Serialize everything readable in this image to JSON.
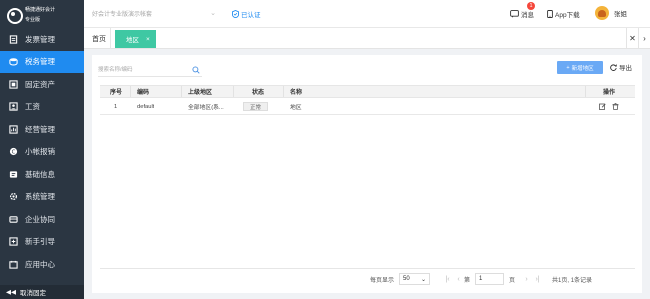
{
  "sidebar": {
    "brand_line1": "畅捷通好会计",
    "brand_line2": "专业版",
    "items": [
      {
        "label": "发票管理",
        "icon": "invoice-icon",
        "active": false
      },
      {
        "label": "税务管理",
        "icon": "tax-icon",
        "active": true
      },
      {
        "label": "固定资产",
        "icon": "asset-icon",
        "active": false
      },
      {
        "label": "工资",
        "icon": "salary-icon",
        "active": false
      },
      {
        "label": "经营管理",
        "icon": "business-icon",
        "active": false
      },
      {
        "label": "小帐报销",
        "icon": "reimburse-icon",
        "active": false
      },
      {
        "label": "基础信息",
        "icon": "info-icon",
        "active": false
      },
      {
        "label": "系统管理",
        "icon": "settings-icon",
        "active": false
      },
      {
        "label": "企业协同",
        "icon": "collab-icon",
        "active": false
      },
      {
        "label": "新手引导",
        "icon": "guide-icon",
        "active": false
      },
      {
        "label": "应用中心",
        "icon": "apps-icon",
        "active": false
      }
    ],
    "footer_label": "取消固定"
  },
  "header": {
    "company_placeholder": "好会计专业版演示帐套",
    "verified_label": "已认证",
    "messages_label": "消息",
    "messages_count": "1",
    "app_download_label": "App下载",
    "user_name": "张姐"
  },
  "tabs": {
    "home_label": "首页",
    "active_label": "地区",
    "close_symbol": "×"
  },
  "toolbar": {
    "search_placeholder": "搜索名称/编码",
    "add_label": "新增地区",
    "export_label": "导出"
  },
  "table": {
    "headers": {
      "index": "序号",
      "code": "编码",
      "parent": "上级地区",
      "status": "状态",
      "name": "名称",
      "actions": "操作"
    },
    "rows": [
      {
        "index": "1",
        "code": "default",
        "parent": "全部地区(系...",
        "status": "正常",
        "name": "地区"
      }
    ]
  },
  "pagination": {
    "per_page_label": "每页显示",
    "per_page_value": "50",
    "page_prefix": "第",
    "page_value": "1",
    "page_suffix": "页",
    "total_text": "共1页, 1条记录"
  },
  "colors": {
    "sidebar_bg": "#2b3642",
    "active_menu": "#1f8bf0",
    "active_tab": "#3fc8a3",
    "add_button": "#6aa9f5"
  }
}
